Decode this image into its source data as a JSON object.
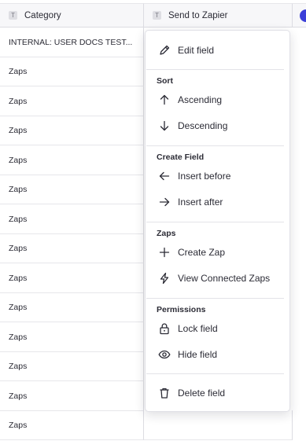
{
  "columns": {
    "category": {
      "label": "Category",
      "type_icon": "T"
    },
    "send_to_zapier": {
      "label": "Send to Zapier",
      "type_icon": "T"
    }
  },
  "rows": [
    "INTERNAL: USER DOCS TEST...",
    "Zaps",
    "Zaps",
    "Zaps",
    "Zaps",
    "Zaps",
    "Zaps",
    "Zaps",
    "Zaps",
    "Zaps",
    "Zaps",
    "Zaps",
    "Zaps",
    "Zaps"
  ],
  "menu": {
    "edit_field": "Edit field",
    "sort": {
      "title": "Sort",
      "ascending": "Ascending",
      "descending": "Descending"
    },
    "create_field": {
      "title": "Create Field",
      "insert_before": "Insert before",
      "insert_after": "Insert after"
    },
    "zaps": {
      "title": "Zaps",
      "create_zap": "Create Zap",
      "view_connected": "View Connected Zaps"
    },
    "permissions": {
      "title": "Permissions",
      "lock_field": "Lock field",
      "hide_field": "Hide field"
    },
    "delete_field": "Delete field"
  },
  "colors": {
    "accent": "#3b3fd8"
  }
}
